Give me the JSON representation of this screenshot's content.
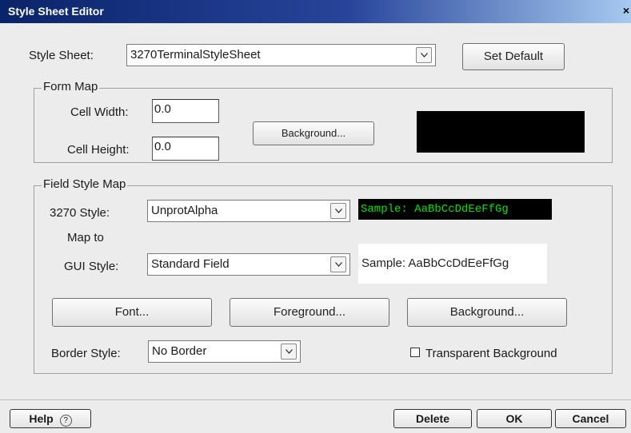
{
  "window": {
    "title": "Style Sheet Editor",
    "close_glyph": "×"
  },
  "style_sheet": {
    "label": "Style Sheet:",
    "value": "3270TerminalStyleSheet",
    "set_default_label": "Set Default"
  },
  "form_map": {
    "legend": "Form Map",
    "cell_width_label": "Cell Width:",
    "cell_width_value": "0.0",
    "cell_height_label": "Cell Height:",
    "cell_height_value": "0.0",
    "background_button": "Background...",
    "swatch_color": "#000000"
  },
  "field_style_map": {
    "legend": "Field Style Map",
    "style_3270_label": "3270 Style:",
    "style_3270_value": "UnprotAlpha",
    "sample_3270": "Sample: AaBbCcDdEeFfGg",
    "map_to_label": "Map to",
    "gui_style_label": "GUI Style:",
    "gui_style_value": "Standard Field",
    "sample_gui": "Sample: AaBbCcDdEeFfGg",
    "font_button": "Font...",
    "foreground_button": "Foreground...",
    "background_button": "Background...",
    "border_style_label": "Border Style:",
    "border_style_value": "No Border",
    "transparent_label": "Transparent Background",
    "transparent_checked": false
  },
  "footer": {
    "help_label": "Help",
    "delete_label": "Delete",
    "ok_label": "OK",
    "cancel_label": "Cancel"
  },
  "colors": {
    "sample_3270_fg": "#00e600",
    "sample_3270_bg": "#000000"
  }
}
